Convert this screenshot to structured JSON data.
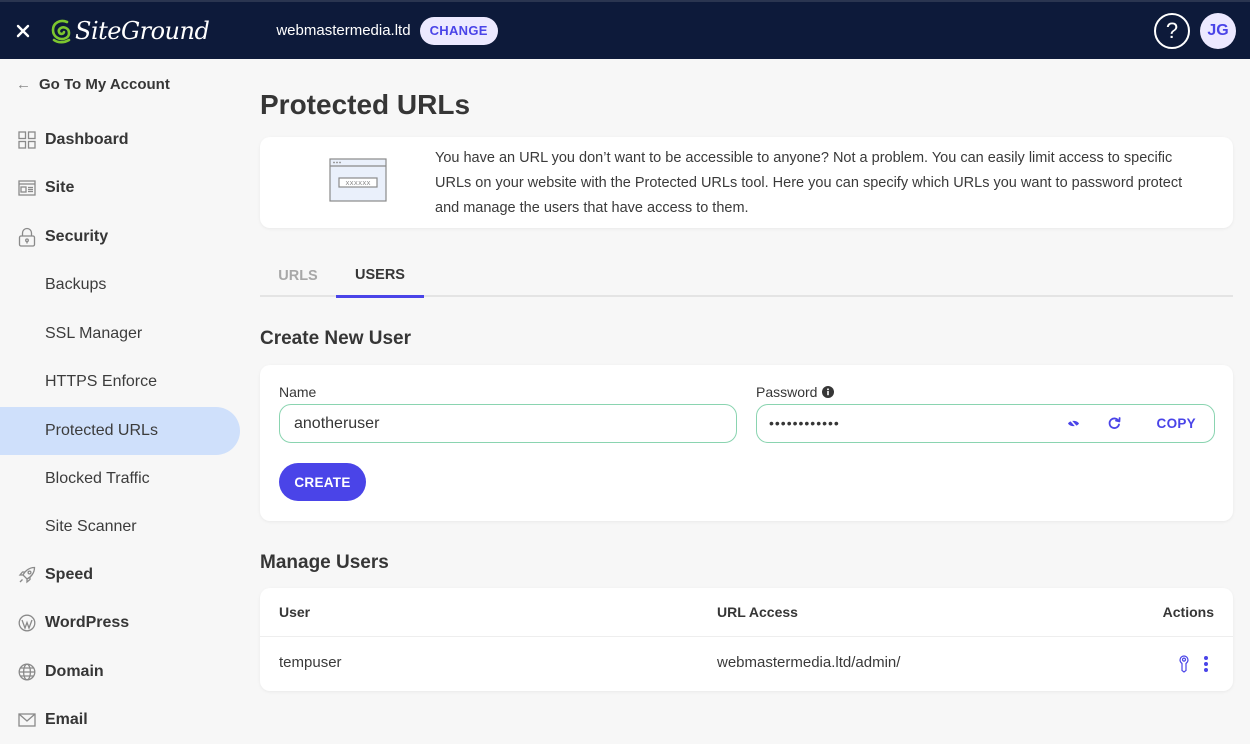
{
  "topbar": {
    "brand": "SiteGround",
    "site_name": "webmastermedia.ltd",
    "change_label": "CHANGE",
    "help_label": "?",
    "avatar_initials": "JG",
    "accent_color": "#4a44e8",
    "bar_color": "#0d1a3a",
    "logo_color": "#7cc62f"
  },
  "sidebar": {
    "back_label": "Go To My Account",
    "items": [
      {
        "label": "Dashboard",
        "icon": "grid-icon",
        "type": "top"
      },
      {
        "label": "Site",
        "icon": "site-icon",
        "type": "top"
      },
      {
        "label": "Security",
        "icon": "lock-icon",
        "type": "top"
      },
      {
        "label": "Backups",
        "type": "sub"
      },
      {
        "label": "SSL Manager",
        "type": "sub"
      },
      {
        "label": "HTTPS Enforce",
        "type": "sub"
      },
      {
        "label": "Protected URLs",
        "type": "sub",
        "active": true
      },
      {
        "label": "Blocked Traffic",
        "type": "sub"
      },
      {
        "label": "Site Scanner",
        "type": "sub"
      },
      {
        "label": "Speed",
        "icon": "rocket-icon",
        "type": "top"
      },
      {
        "label": "WordPress",
        "icon": "wordpress-icon",
        "type": "top"
      },
      {
        "label": "Domain",
        "icon": "globe-icon",
        "type": "top"
      },
      {
        "label": "Email",
        "icon": "mail-icon",
        "type": "top"
      }
    ]
  },
  "main": {
    "title": "Protected URLs",
    "info_text": "You have an URL you don’t want to be accessible to anyone? Not a problem. You can easily limit access to specific URLs on your website with the Protected URLs tool. Here you can specify which URLs you want to password protect and manage the users that have access to them.",
    "info_illustration_mask": "xxxxxx",
    "tabs": [
      {
        "label": "URLS",
        "active": false
      },
      {
        "label": "USERS",
        "active": true
      }
    ],
    "create_section": {
      "title": "Create New User",
      "name_label": "Name",
      "name_value": "anotheruser",
      "password_label": "Password",
      "password_value": "••••••••••••",
      "copy_label": "COPY",
      "create_label": "CREATE"
    },
    "manage_section": {
      "title": "Manage Users",
      "columns": [
        "User",
        "URL Access",
        "Actions"
      ],
      "rows": [
        {
          "user": "tempuser",
          "url_access": "webmastermedia.ltd/admin/"
        }
      ]
    }
  }
}
